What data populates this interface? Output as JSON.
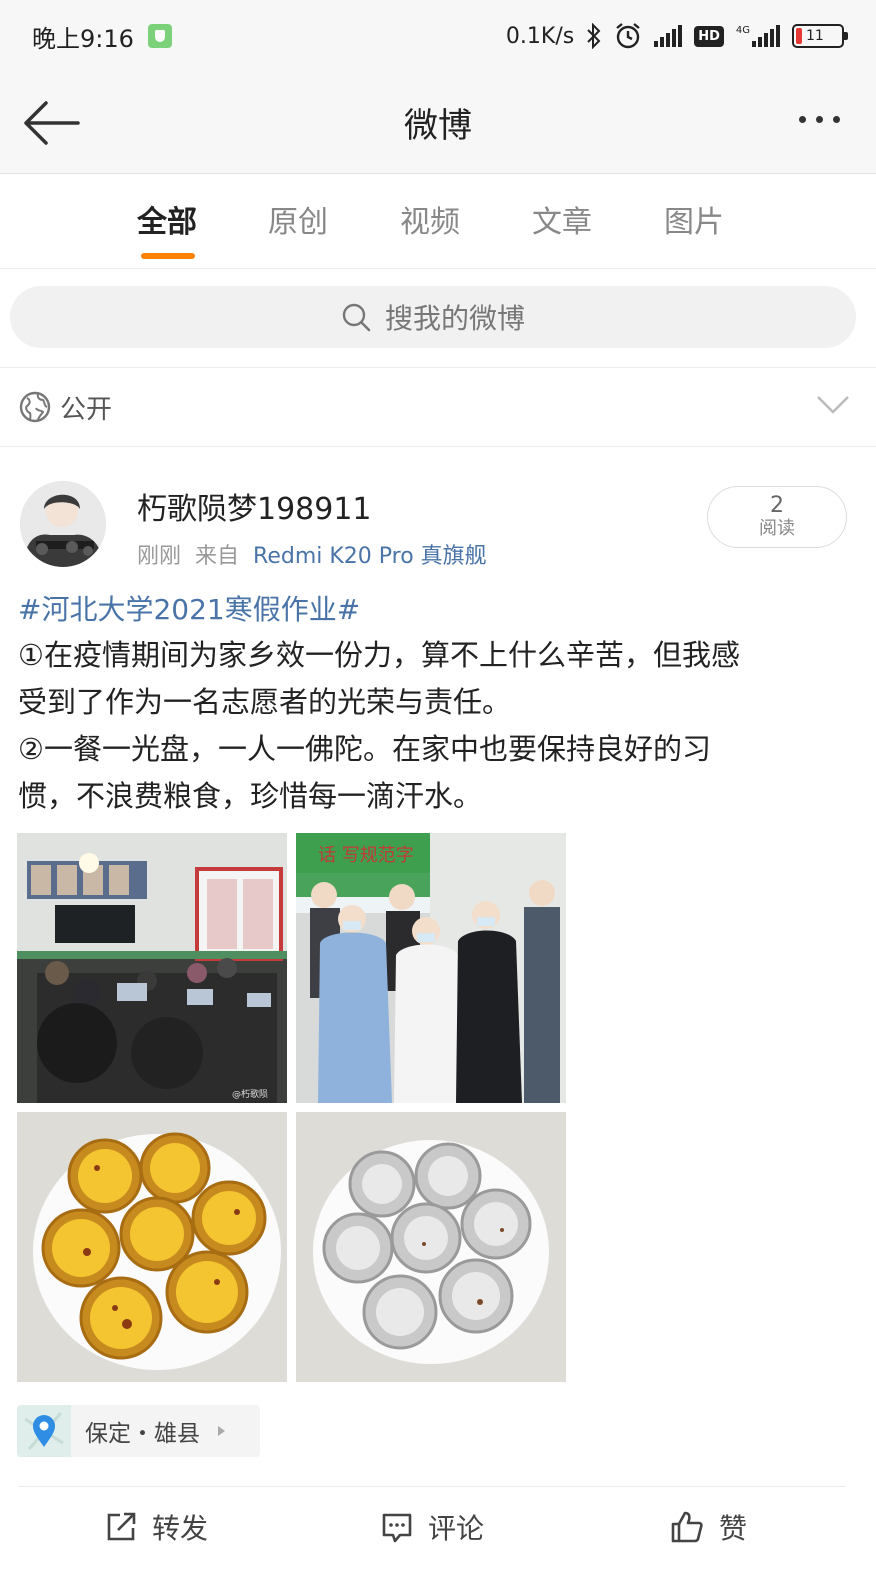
{
  "status_bar": {
    "time": "晚上9:16",
    "net_speed": "0.1K/s",
    "network": "4G",
    "battery": "11"
  },
  "header": {
    "title": "微博"
  },
  "tabs": [
    {
      "label": "全部",
      "active": true
    },
    {
      "label": "原创",
      "active": false
    },
    {
      "label": "视频",
      "active": false
    },
    {
      "label": "文章",
      "active": false
    },
    {
      "label": "图片",
      "active": false
    }
  ],
  "search": {
    "placeholder": "搜我的微博"
  },
  "visibility": {
    "label": "公开"
  },
  "post": {
    "username": "朽歌陨梦198911",
    "time": "刚刚",
    "from_prefix": "来自",
    "source": "Redmi K20 Pro 真旗舰",
    "reads_count": "2",
    "reads_label": "阅读",
    "hashtag": "#河北大学2021寒假作业#",
    "lines": [
      "①在疫情期间为家乡效一份力，算不上什么辛苦，但我感",
      "受到了作为一名志愿者的光荣与责任。",
      "②一餐一光盘，一人一佛陀。在家中也要保持良好的习",
      "惯，不浪费粮食，珍惜每一滴汗水。"
    ],
    "photo_watermark": "@朽歌陨",
    "poster_text": "话 写规范字",
    "location": "保定・雄县"
  },
  "actions": {
    "repost": "转发",
    "comment": "评论",
    "like": "赞"
  },
  "colors": {
    "accent": "#ff8200",
    "link": "#4a74a8",
    "battery_low": "#e53935"
  }
}
